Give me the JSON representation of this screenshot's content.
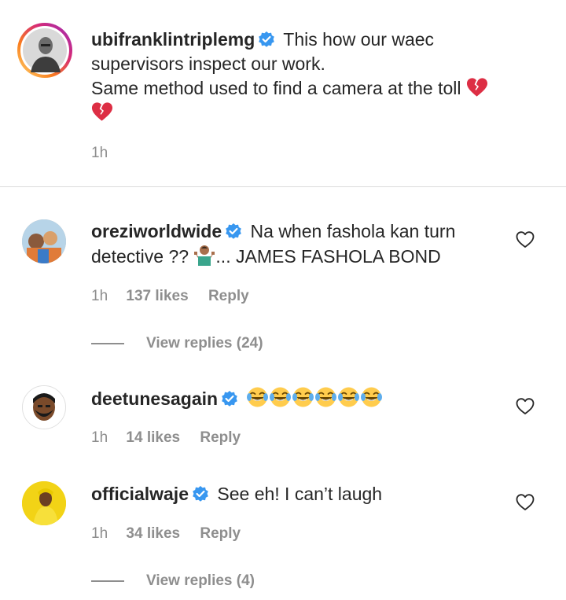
{
  "caption": {
    "username": "ubifranklintriplemg",
    "line1": "This how our waec",
    "line2": "supervisors inspect our work.",
    "line3": "Same method used to find a camera at the toll",
    "emoji": "broken-heart-emoji",
    "time": "1h"
  },
  "comments": [
    {
      "username": "oreziworldwide",
      "line1": "Na when fashola kan turn",
      "line2a": "detective ??",
      "line2b": "... JAMES FASHOLA BOND",
      "time": "1h",
      "likes": "137 likes",
      "reply": "Reply",
      "view_replies": "View replies (24)"
    },
    {
      "username": "deetunesagain",
      "emoji": "laughing-tears-emoji",
      "time": "1h",
      "likes": "14 likes",
      "reply": "Reply"
    },
    {
      "username": "officialwaje",
      "text": "See eh! I can’t laugh",
      "time": "1h",
      "likes": "34 likes",
      "reply": "Reply",
      "view_replies": "View replies (4)"
    }
  ],
  "colors": {
    "verified": "#3897f0",
    "muted": "#8e8e8e",
    "text": "#262626"
  }
}
